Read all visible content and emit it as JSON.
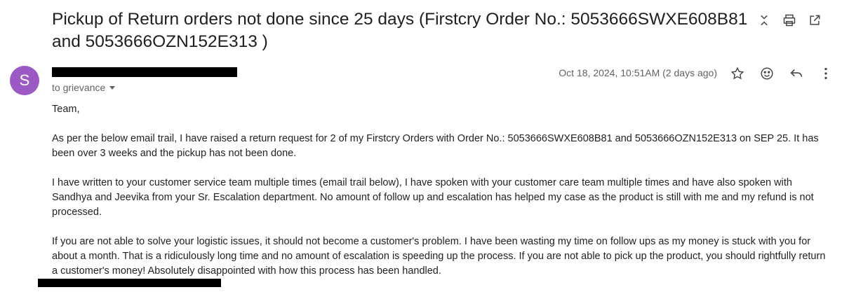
{
  "email": {
    "subject": "Pickup of Return orders not done since 25 days (Firstcry Order No.: 5053666SWXE608B81 and 5053666OZN152E313 )",
    "avatar_initial": "S",
    "avatar_color": "#9b59c4",
    "recipient_text": "to grievance",
    "date": "Oct 18, 2024, 10:51AM (2 days ago)",
    "greeting": "Team,",
    "paragraphs": [
      "As per the below email trail, I have raised a return request for 2 of my Firstcry Orders with Order No.: 5053666SWXE608B81 and 5053666OZN152E313 on SEP 25. It has been over 3 weeks and the pickup has not been done.",
      "I have written to your customer service team multiple times (email trail below), I have spoken with your customer care team multiple times and have also spoken with Sandhya and Jeevika from your Sr. Escalation department. No amount of follow up and escalation has helped my case as the product is still with me and my refund is not processed.",
      "If you are not able to solve your logistic issues, it should not become a customer's problem. I have been wasting my time on follow ups as my money is stuck with you for about a month. That is a ridiculously long time and no amount of escalation is speeding up the process. If you are not able to pick up the product, you should rightfully return a customer's money! Absolutely disappointed with how this process has been handled."
    ]
  },
  "icons": {
    "top": [
      "collapse-icon",
      "print-icon",
      "open-in-new-window-icon"
    ],
    "message": [
      "star-icon",
      "emoji-reaction-icon",
      "reply-icon",
      "more-options-icon"
    ]
  }
}
